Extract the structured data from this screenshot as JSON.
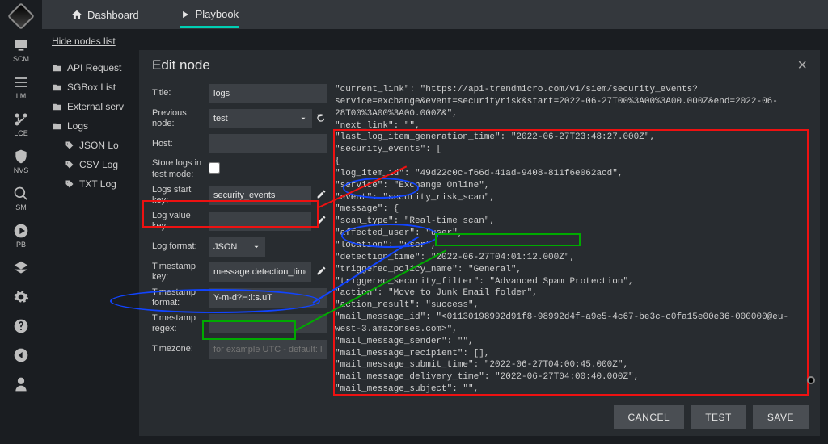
{
  "rail": {
    "items": [
      {
        "key": "scm",
        "label": "SCM",
        "icon": "monitor"
      },
      {
        "key": "lm",
        "label": "LM",
        "icon": "bars"
      },
      {
        "key": "lce",
        "label": "LCE",
        "icon": "branch"
      },
      {
        "key": "nvs",
        "label": "NVS",
        "icon": "shield"
      },
      {
        "key": "sm",
        "label": "SM",
        "icon": "search"
      },
      {
        "key": "pb",
        "label": "PB",
        "icon": "play"
      },
      {
        "key": "layers",
        "label": "",
        "icon": "layers"
      },
      {
        "key": "gear",
        "label": "",
        "icon": "gear"
      },
      {
        "key": "help",
        "label": "",
        "icon": "help"
      },
      {
        "key": "back",
        "label": "",
        "icon": "back"
      },
      {
        "key": "user",
        "label": "",
        "icon": "user"
      }
    ]
  },
  "topnav": {
    "dashboard": "Dashboard",
    "playbook": "Playbook"
  },
  "tree": {
    "hide": "Hide nodes list",
    "groups": [
      {
        "label": "API Request",
        "icon": "folder"
      },
      {
        "label": "SGBox List",
        "icon": "folder"
      },
      {
        "label": "External serv",
        "icon": "folder"
      },
      {
        "label": "Logs",
        "icon": "folder",
        "children": [
          {
            "label": "JSON Lo",
            "icon": "tag"
          },
          {
            "label": "CSV Log",
            "icon": "tag"
          },
          {
            "label": "TXT Log",
            "icon": "tag"
          }
        ]
      }
    ]
  },
  "modal": {
    "title": "Edit node",
    "form": {
      "title_label": "Title:",
      "title_value": "logs",
      "prevnode_label": "Previous node:",
      "prevnode_value": "test",
      "host_label": "Host:",
      "host_value": "",
      "store_label": "Store logs in test mode:",
      "store_checked": false,
      "logs_start_label": "Logs start key:",
      "logs_start_value": "security_events",
      "log_value_label": "Log value key:",
      "log_value_value": "",
      "log_format_label": "Log format:",
      "log_format_value": "JSON",
      "ts_key_label": "Timestamp key:",
      "ts_key_value": "message.detection_time",
      "ts_format_label": "Timestamp format:",
      "ts_format_value": "Y-m-d?H:i:s.uT",
      "ts_regex_label": "Timestamp regex:",
      "ts_regex_value": "",
      "timezone_label": "Timezone:",
      "timezone_placeholder": "for example UTC - default: lo"
    },
    "preview": "\"current_link\": \"https://api-trendmicro.com/v1/siem/security_events?service=exchange&event=securityrisk&start=2022-06-27T00%3A00%3A00.000Z&end=2022-06-28T00%3A00%3A00.000Z&\",\n\"next_link\": \"\",\n\"last_log_item_generation_time\": \"2022-06-27T23:48:27.000Z\",\n\"security_events\": [\n{\n\"log_item_id\": \"49d22c0c-f66d-41ad-9408-811f6e062acd\",\n\"service\": \"Exchange Online\",\n\"event\": \"security_risk_scan\",\n\"message\": {\n\"scan_type\": \"Real-time scan\",\n\"affected_user\": \"user\",\n\"location\": \"user\",\n\"detection_time\": \"2022-06-27T04:01:12.000Z\",\n\"triggered_policy_name\": \"General\",\n\"triggered_security_filter\": \"Advanced Spam Protection\",\n\"action\": \"Move to Junk Email folder\",\n\"action_result\": \"success\",\n\"mail_message_id\": \"<01130198992d91f8-98992d4f-a9e5-4c67-be3c-c0fa15e00e36-000000@eu-west-3.amazonses.com>\",\n\"mail_message_sender\": \"\",\n\"mail_message_recipient\": [],\n\"mail_message_submit_time\": \"2022-06-27T04:00:45.000Z\",\n\"mail_message_delivery_time\": \"2022-06-27T04:00:40.000Z\",\n\"mail_message_subject\": \"\",\n\"mail_message_file_name\": \"\",\n",
    "buttons": {
      "cancel": "CANCEL",
      "test": "TEST",
      "save": "SAVE"
    }
  }
}
